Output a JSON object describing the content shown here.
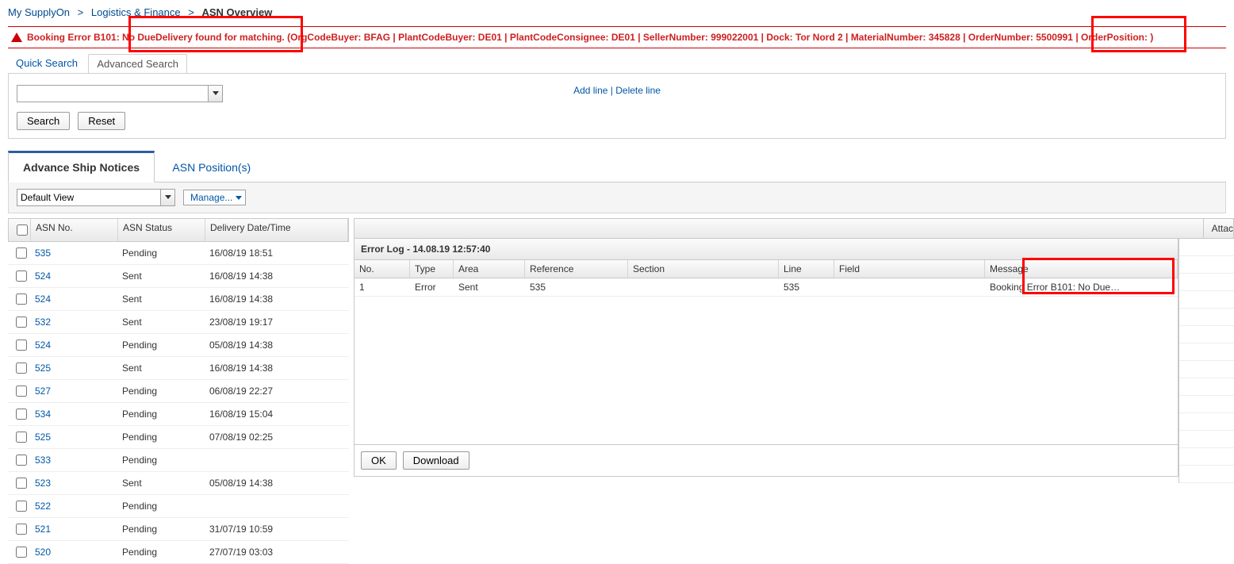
{
  "breadcrumb": {
    "items": [
      "My SupplyOn",
      "Logistics & Finance"
    ],
    "current": "ASN Overview"
  },
  "error_banner": {
    "prefix": "Booking Error B101:",
    "highlight1": "No DueDelivery found for matching.",
    "mid": "(OrgCodeBuyer: BFAG | PlantCodeBuyer: DE01 | PlantCodeConsignee: DE01 | SellerNumber: 999022001 | Dock: Tor Nord 2 | MaterialNumber: 345828 | OrderNumber: 5500991",
    "highlight2": "| OrderPosition: )"
  },
  "search": {
    "tabs": {
      "quick": "Quick Search",
      "advanced": "Advanced Search"
    },
    "add_line": "Add line",
    "delete_line": "Delete line",
    "search_btn": "Search",
    "reset_btn": "Reset"
  },
  "main_tabs": {
    "asn": "Advance Ship Notices",
    "pos": "ASN Position(s)"
  },
  "toolbar": {
    "view": "Default View",
    "manage": "Manage..."
  },
  "grid": {
    "headers": {
      "asn_no": "ASN No.",
      "status": "ASN Status",
      "date": "Delivery Date/Time"
    },
    "rows": [
      {
        "no": "535",
        "status": "Pending",
        "date": "16/08/19 18:51"
      },
      {
        "no": "524",
        "status": "Sent",
        "date": "16/08/19 14:38"
      },
      {
        "no": "524",
        "status": "Sent",
        "date": "16/08/19 14:38"
      },
      {
        "no": "532",
        "status": "Sent",
        "date": "23/08/19 19:17"
      },
      {
        "no": "524",
        "status": "Pending",
        "date": "05/08/19 14:38"
      },
      {
        "no": "525",
        "status": "Sent",
        "date": "16/08/19 14:38"
      },
      {
        "no": "527",
        "status": "Pending",
        "date": "06/08/19 22:27"
      },
      {
        "no": "534",
        "status": "Pending",
        "date": "16/08/19 15:04"
      },
      {
        "no": "525",
        "status": "Pending",
        "date": "07/08/19 02:25"
      },
      {
        "no": "533",
        "status": "Pending",
        "date": ""
      },
      {
        "no": "523",
        "status": "Sent",
        "date": "05/08/19 14:38"
      },
      {
        "no": "522",
        "status": "Pending",
        "date": ""
      },
      {
        "no": "521",
        "status": "Pending",
        "date": "31/07/19 10:59"
      },
      {
        "no": "520",
        "status": "Pending",
        "date": "27/07/19 03:03"
      }
    ]
  },
  "right": {
    "attach_col": "Attac"
  },
  "errlog": {
    "title": "Error Log - 14.08.19 12:57:40",
    "headers": {
      "no": "No.",
      "type": "Type",
      "area": "Area",
      "ref": "Reference",
      "sec": "Section",
      "line": "Line",
      "field": "Field",
      "msg": "Message"
    },
    "rows": [
      {
        "no": "1",
        "type": "Error",
        "area": "Sent",
        "ref": "535",
        "sec": "",
        "line": "535",
        "field": "",
        "msg": "Booking Error B101: No Due…"
      }
    ],
    "ok": "OK",
    "download": "Download"
  }
}
